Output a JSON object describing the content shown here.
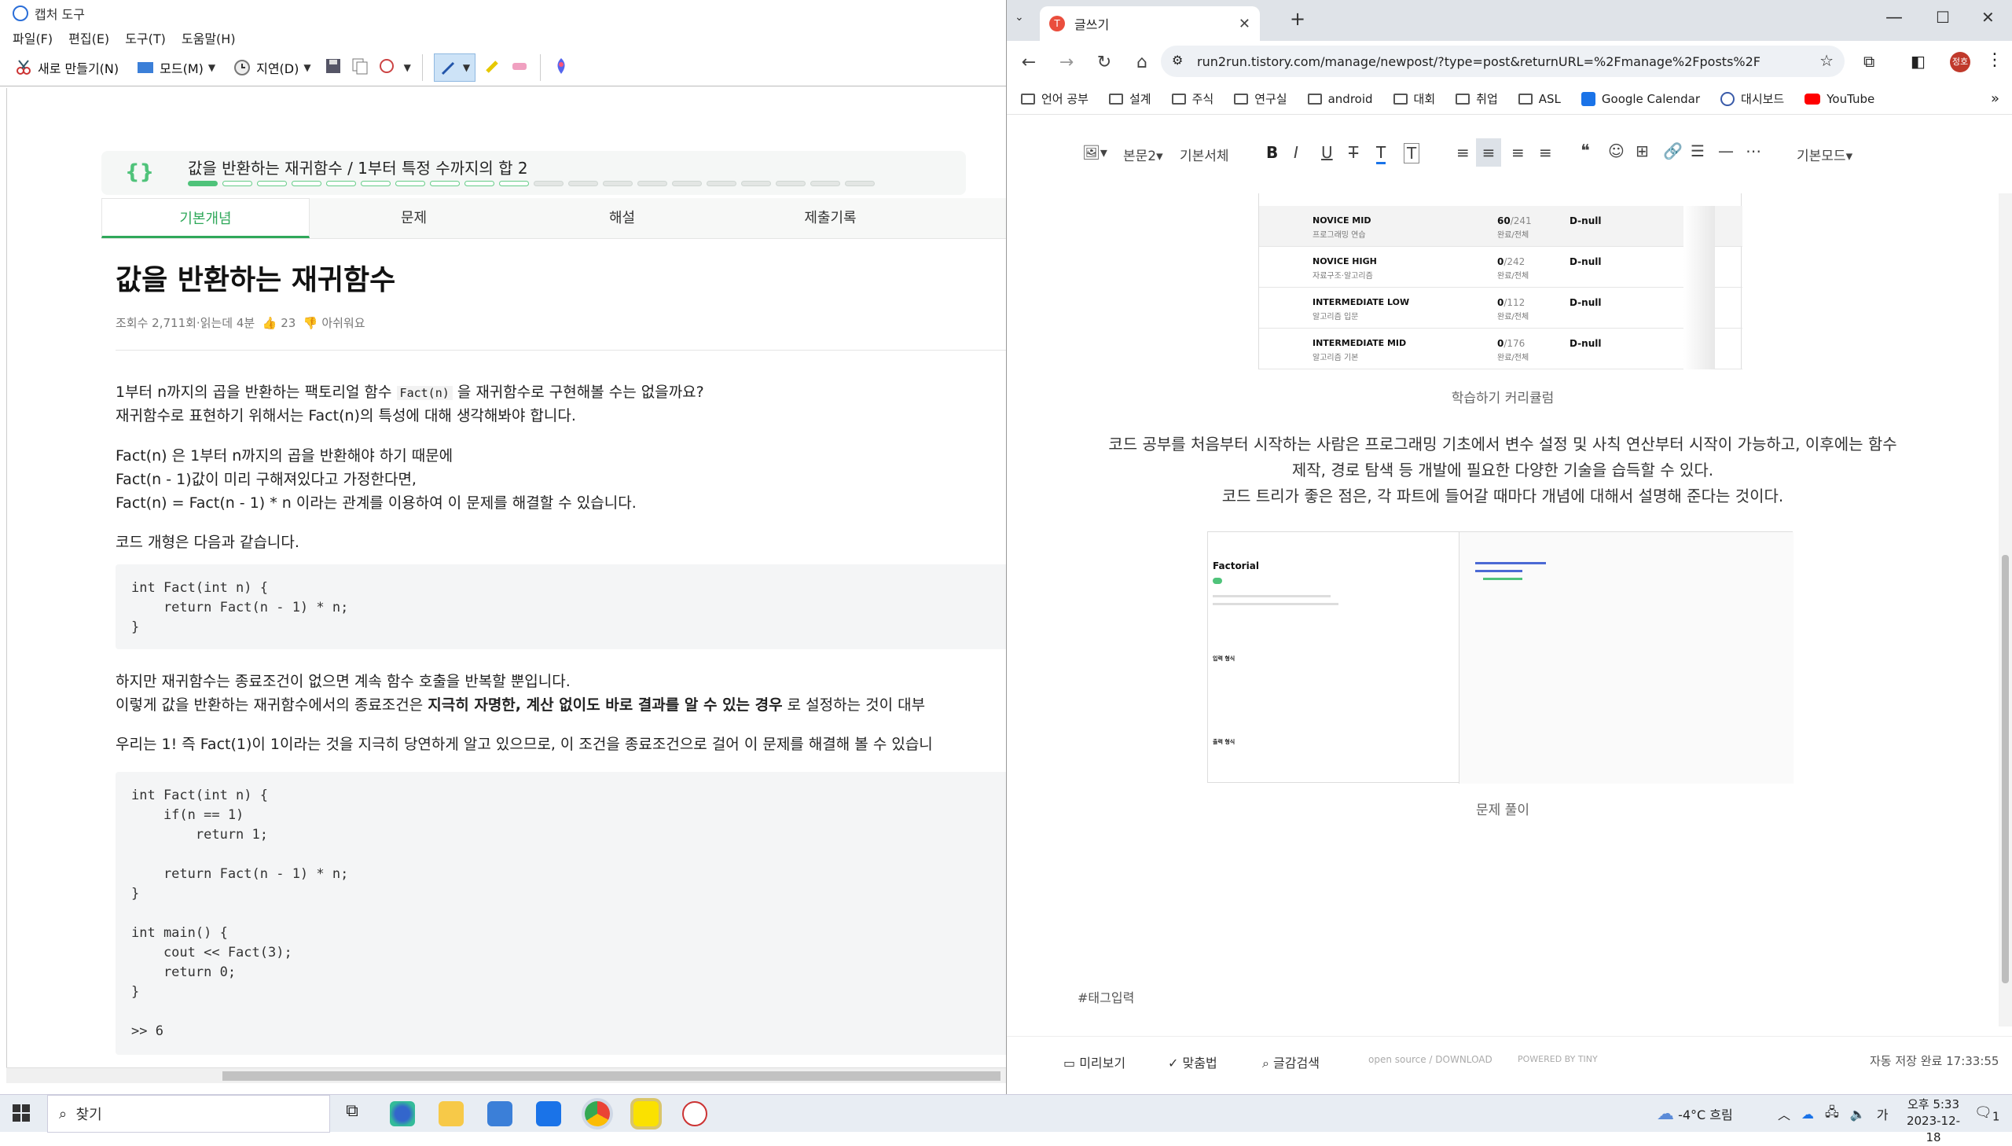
{
  "snip": {
    "title": "캡처 도구",
    "menu": [
      "파일(F)",
      "편집(E)",
      "도구(T)",
      "도움말(H)"
    ],
    "toolbar": {
      "new": "새로 만들기(N)",
      "mode": "모드(M)",
      "delay": "지연(D)"
    },
    "lesson": {
      "header_title": "값을 반환하는 재귀함수 / 1부터 특정 수까지의 합 2",
      "tabs": [
        "기본개념",
        "문제",
        "해설",
        "제출기록"
      ],
      "heading": "값을 반환하는 재귀함수",
      "meta": {
        "views": "조회수 2,711회",
        "read": "·읽는데 4분",
        "likes": "23",
        "dislike": "아쉬워요"
      },
      "p1a": "1부터 n까지의 곱을 반환하는 팩토리얼 함수",
      "p1code": "Fact(n)",
      "p1b": "을 재귀함수로 구현해볼 수는 없을까요?",
      "p2": "재귀함수로 표현하기 위해서는 Fact(n)의 특성에 대해 생각해봐야 합니다.",
      "p3": "Fact(n) 은 1부터 n까지의 곱을 반환해야 하기 때문에",
      "p4": "Fact(n - 1)값이 미리 구해져있다고 가정한다면,",
      "p5": "Fact(n) = Fact(n - 1) * n 이라는 관계를 이용하여 이 문제를 해결할 수 있습니다.",
      "p6": "코드 개형은 다음과 같습니다.",
      "code1": [
        "int Fact(int n) {",
        "    return Fact(n - 1) * n;",
        "}"
      ],
      "p7": "하지만 재귀함수는 종료조건이 없으면 계속 함수 호출을 반복할 뿐입니다.",
      "p8a": "이렇게 값을 반환하는 재귀함수에서의 종료조건은",
      "p8b": "지극히 자명한, 계산 없이도 바로 결과를 알 수 있는 경우",
      "p8c": "로 설정하는 것이 대부",
      "p9": "우리는 1! 즉 Fact(1)이 1이라는 것을 지극히 당연하게 알고 있으므로, 이 조건을 종료조건으로 걸어 이 문제를 해결해 볼 수 있습니",
      "code2": [
        "int Fact(int n) {",
        "    if(n == 1)",
        "        return 1;",
        "",
        "    return Fact(n - 1) * n;",
        "}",
        "",
        "int main() {",
        "    cout << Fact(3);",
        "    return 0;",
        "}",
        "",
        ">> 6"
      ]
    }
  },
  "chrome": {
    "tab_title": "글쓰기",
    "url": "run2run.tistory.com/manage/newpost/?type=post&returnURL=%2Fmanage%2Fposts%2F",
    "bookmarks": [
      "언어 공부",
      "설계",
      "주식",
      "연구실",
      "android",
      "대회",
      "취업",
      "ASL",
      "Google Calendar",
      "대시보드",
      "YouTube"
    ],
    "editor_toolbar": {
      "paragraph": "본문2",
      "font": "기본서체",
      "mode": "기본모드"
    },
    "curriculum": [
      {
        "name": "NOVICE MID",
        "sub": "프로그래밍 연습",
        "count": "60",
        "total": "/241",
        "done": "완료/전체",
        "d": "D-null"
      },
      {
        "name": "NOVICE HIGH",
        "sub": "자료구조·알고리즘",
        "count": "0",
        "total": "/242",
        "done": "완료/전체",
        "d": "D-null"
      },
      {
        "name": "INTERMEDIATE LOW",
        "sub": "알고리즘 입문",
        "count": "0",
        "total": "/112",
        "done": "완료/전체",
        "d": "D-null"
      },
      {
        "name": "INTERMEDIATE MID",
        "sub": "알고리즘 기본",
        "count": "0",
        "total": "/176",
        "done": "완료/전체",
        "d": "D-null"
      }
    ],
    "caption1": "학습하기 커리큘럼",
    "body1": "코드 공부를 처음부터 시작하는 사람은 프로그래밍 기초에서 변수 설정 및 사칙 연산부터 시작이 가능하고, 이후에는 함수",
    "body2": "제작, 경로 탐색 등 개발에 필요한 다양한 기술을 습득할 수 있다.",
    "body3": "코드 트리가 좋은 점은, 각 파트에 들어갈 때마다 개념에 대해서 설명해 준다는 것이다.",
    "shot_title": "Factorial",
    "shot_input": "입력 형식",
    "shot_output": "출력 형식",
    "caption2": "문제 풀이",
    "tag_input": "#태그입력",
    "footer": {
      "preview": "미리보기",
      "spell": "맞춤법",
      "search": "글감검색",
      "opensource": "open source / DOWNLOAD",
      "tiny": "POWERED BY TINY",
      "saved": "자동 저장 완료 17:33:55"
    }
  },
  "taskbar": {
    "search": "찾기",
    "weather": "-4°C  흐림",
    "ime": "가",
    "time": "오후 5:33",
    "date": "2023-12-18",
    "notif": "1"
  }
}
